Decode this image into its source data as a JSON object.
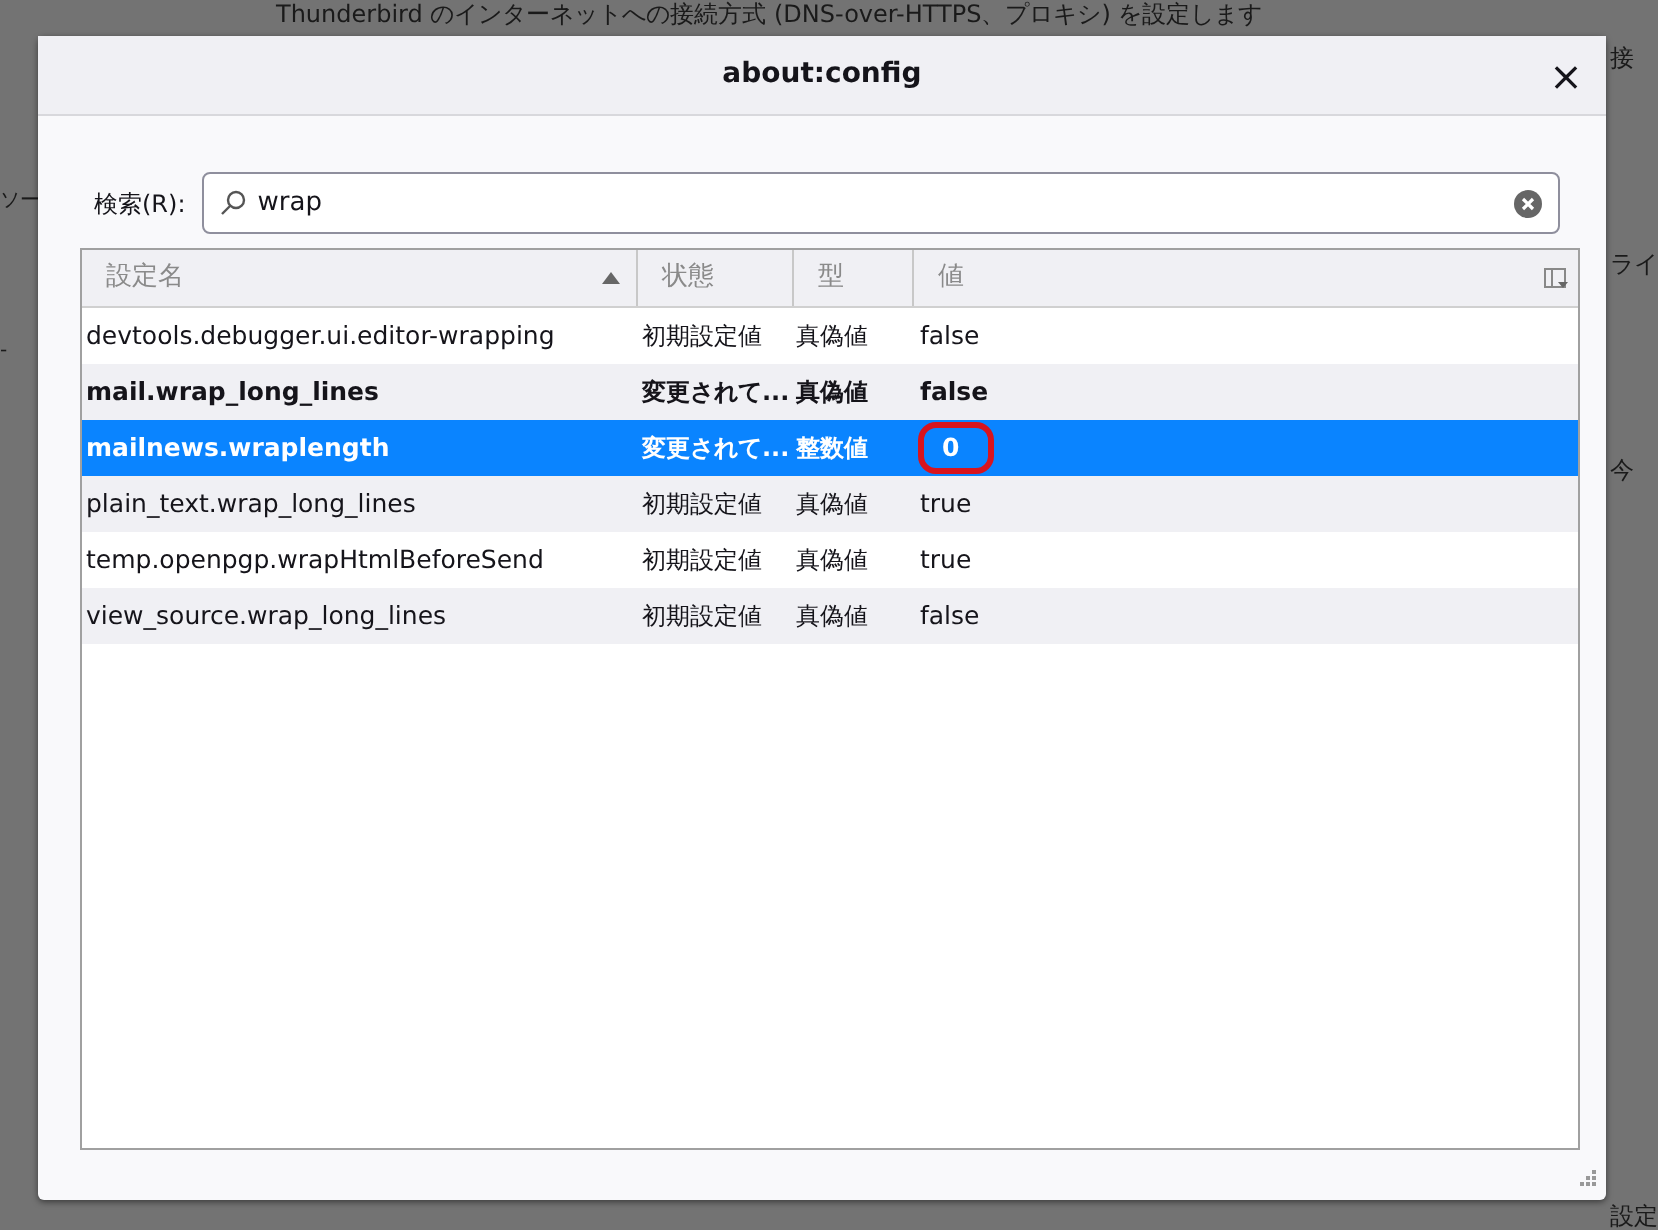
{
  "background": {
    "top_line": "Thunderbird のインターネットへの接続方式 (DNS-over-HTTPS、プロキシ) を設定します",
    "left_fragments": [
      "ソー",
      "-"
    ],
    "right_fragments": [
      "接",
      "ライ",
      "今"
    ],
    "bottom_fragment": "設定"
  },
  "dialog": {
    "title": "about:config",
    "close": "×"
  },
  "search": {
    "label": "検索(R):",
    "value": "wrap"
  },
  "table": {
    "columns": [
      {
        "label": "設定名",
        "sorted": true
      },
      {
        "label": "状態",
        "sorted": false
      },
      {
        "label": "型",
        "sorted": false
      },
      {
        "label": "値",
        "sorted": false
      }
    ],
    "rows": [
      {
        "name": "devtools.debugger.ui.editor-wrapping",
        "state": "初期設定値",
        "type": "真偽値",
        "value": "false",
        "modified": false,
        "selected": false,
        "circled": false
      },
      {
        "name": "mail.wrap_long_lines",
        "state": "変更されて...",
        "type": "真偽値",
        "value": "false",
        "modified": true,
        "selected": false,
        "circled": false
      },
      {
        "name": "mailnews.wraplength",
        "state": "変更されて...",
        "type": "整数値",
        "value": "0",
        "modified": true,
        "selected": true,
        "circled": true
      },
      {
        "name": "plain_text.wrap_long_lines",
        "state": "初期設定値",
        "type": "真偽値",
        "value": "true",
        "modified": false,
        "selected": false,
        "circled": false
      },
      {
        "name": "temp.openpgp.wrapHtmlBeforeSend",
        "state": "初期設定値",
        "type": "真偽値",
        "value": "true",
        "modified": false,
        "selected": false,
        "circled": false
      },
      {
        "name": "view_source.wrap_long_lines",
        "state": "初期設定値",
        "type": "真偽値",
        "value": "false",
        "modified": false,
        "selected": false,
        "circled": false
      }
    ]
  }
}
